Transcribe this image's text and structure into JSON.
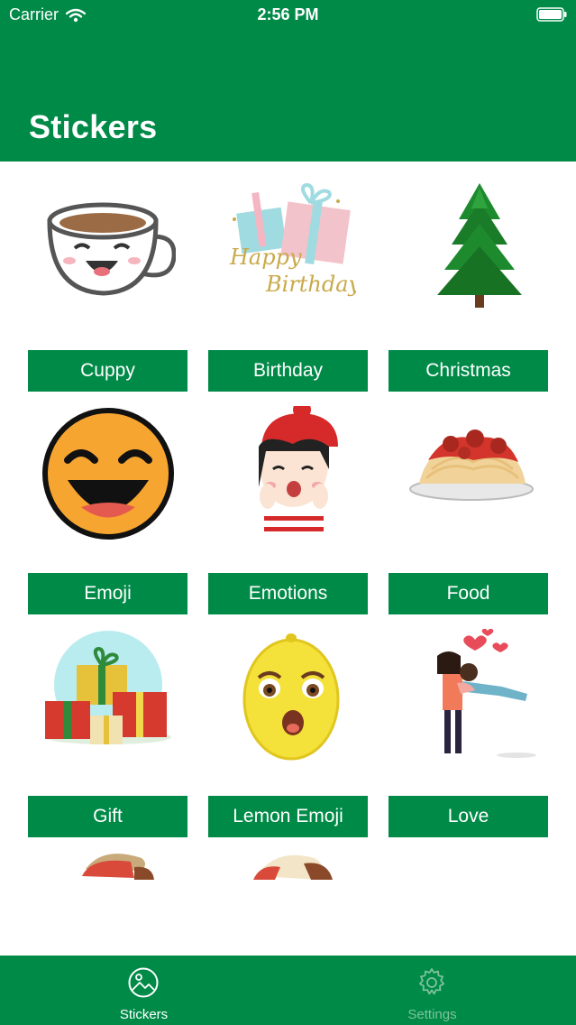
{
  "status_bar": {
    "carrier": "Carrier",
    "time": "2:56 PM"
  },
  "header": {
    "title": "Stickers"
  },
  "stickers": [
    {
      "label": "Cuppy",
      "icon": "cup-sticker-icon"
    },
    {
      "label": "Birthday",
      "icon": "birthday-gift-sticker-icon"
    },
    {
      "label": "Christmas",
      "icon": "christmas-tree-sticker-icon"
    },
    {
      "label": "Emoji",
      "icon": "smiley-emoji-sticker-icon"
    },
    {
      "label": "Emotions",
      "icon": "girl-emotions-sticker-icon"
    },
    {
      "label": "Food",
      "icon": "spaghetti-sticker-icon"
    },
    {
      "label": "Gift",
      "icon": "gift-boxes-sticker-icon"
    },
    {
      "label": "Lemon Emoji",
      "icon": "lemon-emoji-sticker-icon"
    },
    {
      "label": "Love",
      "icon": "couple-love-sticker-icon"
    }
  ],
  "tabs": [
    {
      "label": "Stickers",
      "icon": "stickers-tab-icon",
      "selected": true
    },
    {
      "label": "Settings",
      "icon": "gear-icon",
      "selected": false
    }
  ],
  "colors": {
    "brand_green": "#008a48",
    "inactive_tab": "#7ec29c"
  }
}
